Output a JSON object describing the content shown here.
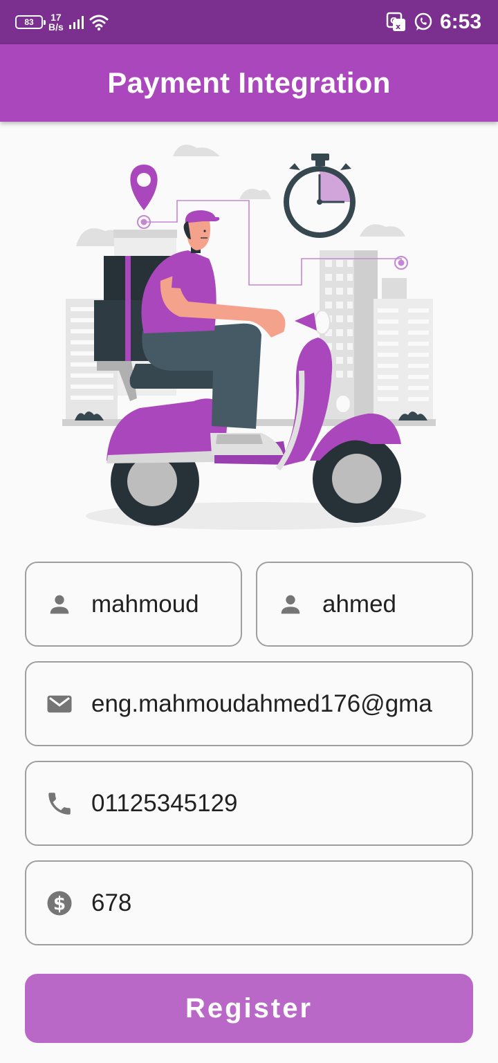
{
  "status_bar": {
    "battery": "83",
    "net_speed_value": "17",
    "net_speed_unit": "B/s",
    "time": "6:53",
    "icons": [
      "battery-icon",
      "signal-icon",
      "wifi-icon",
      "translate-icon",
      "whatsapp-icon"
    ]
  },
  "app_bar": {
    "title": "Payment Integration"
  },
  "illustration": {
    "name": "delivery-scooter-illustration"
  },
  "form": {
    "first_name": {
      "value": "mahmoud",
      "icon": "person-icon"
    },
    "last_name": {
      "value": "ahmed",
      "icon": "person-icon"
    },
    "email": {
      "value": "eng.mahmoudahmed176@gma",
      "icon": "mail-icon"
    },
    "phone": {
      "value": "01125345129",
      "icon": "phone-icon"
    },
    "amount": {
      "value": "678",
      "icon": "dollar-icon"
    }
  },
  "register_button": {
    "label": "Register"
  },
  "colors": {
    "status_bar": "#7b2f8e",
    "app_bar": "#ab47bc",
    "button": "#ba68c8",
    "field_border": "#9e9e9e",
    "icon": "#757575"
  }
}
